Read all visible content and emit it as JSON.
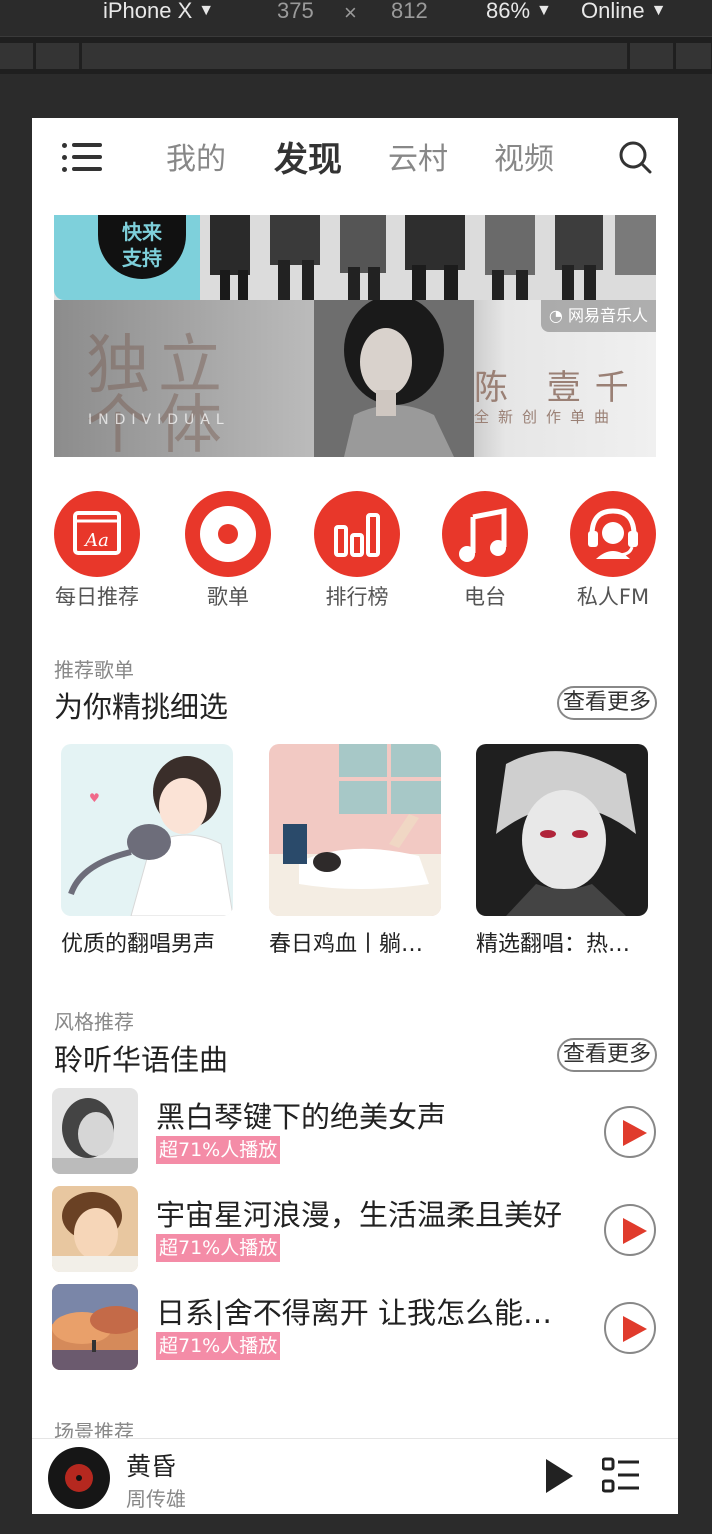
{
  "devtools": {
    "device": "iPhone X",
    "width": "375",
    "times": "×",
    "height": "812",
    "zoom": "86%",
    "network": "Online",
    "caret": "▼"
  },
  "nav": {
    "tabs": [
      "我的",
      "发现",
      "云村",
      "视频"
    ],
    "active_tab": "发现"
  },
  "banner": {
    "badge_line1": "快来",
    "badge_line2": "支持",
    "big_title": "独立\n个体",
    "english": "INDIVIDUAL",
    "artist": "陈 壹千",
    "subtitle": "全新创作单曲",
    "label": "网易音乐人"
  },
  "quick_entries": [
    {
      "label": "每日推荐",
      "icon": "calendar-icon"
    },
    {
      "label": "歌单",
      "icon": "disc-icon"
    },
    {
      "label": "排行榜",
      "icon": "chart-bars-icon"
    },
    {
      "label": "电台",
      "icon": "music-note-icon"
    },
    {
      "label": "私人FM",
      "icon": "headset-icon"
    }
  ],
  "playlist_section": {
    "subtitle": "推荐歌单",
    "title": "为你精挑细选",
    "more": "查看更多",
    "items": [
      {
        "title": "优质的翻唱男声"
      },
      {
        "title": "春日鸡血丨躺在床上听的歌"
      },
      {
        "title": "精选翻唱：热门歌曲"
      }
    ]
  },
  "style_section": {
    "subtitle": "风格推荐",
    "title": "聆听华语佳曲",
    "more": "查看更多",
    "songs": [
      {
        "name": "黑白琴键下的绝美女声",
        "tag": "超71%人播放"
      },
      {
        "name": "宇宙星河浪漫，生活温柔且美好",
        "tag": "超71%人播放"
      },
      {
        "name": "日系|舍不得离开 让我怎么能忘记",
        "tag": "超71%人播放"
      }
    ]
  },
  "scene_section": {
    "subtitle": "场景推荐"
  },
  "player": {
    "song": "黄昏",
    "artist": "周传雄"
  }
}
